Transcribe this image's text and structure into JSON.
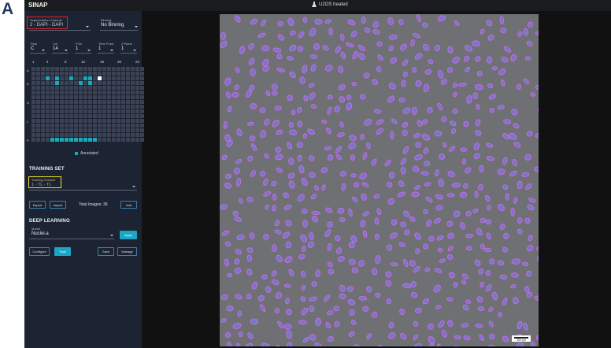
{
  "panel_letter": "A",
  "app": {
    "title": "SINAP",
    "topbar_label": "U2OS treated"
  },
  "sidebar": {
    "segmentation_channel": {
      "label": "Segmentation Channel",
      "value": "2 - DAPI - DAPI"
    },
    "binning": {
      "label": "Binning",
      "value": "No Binning"
    },
    "selectors": [
      {
        "label": "Row",
        "value": "C"
      },
      {
        "label": "Col",
        "value": "14"
      },
      {
        "label": "FOV",
        "value": "1"
      },
      {
        "label": "Time Point",
        "value": "1"
      },
      {
        "label": "Z Plane",
        "value": "1"
      }
    ],
    "plate": {
      "col_ticks": [
        "1",
        "4",
        "8",
        "12",
        "16",
        "20",
        "24"
      ],
      "row_labels": [
        "A",
        "D",
        "H",
        "L",
        "P"
      ],
      "rows": 16,
      "cols": 24,
      "annotated_wells": [
        [
          2,
          3
        ],
        [
          2,
          5
        ],
        [
          2,
          8
        ],
        [
          2,
          11
        ],
        [
          2,
          12
        ],
        [
          3,
          5
        ],
        [
          3,
          10
        ],
        [
          3,
          12
        ],
        [
          15,
          4
        ],
        [
          15,
          5
        ],
        [
          15,
          6
        ],
        [
          15,
          7
        ],
        [
          15,
          8
        ],
        [
          15,
          9
        ],
        [
          15,
          10
        ],
        [
          15,
          11
        ],
        [
          15,
          12
        ],
        [
          15,
          13
        ]
      ],
      "selected_well": [
        2,
        14
      ],
      "legend": "Annotated"
    },
    "training_set": {
      "heading": "TRAINING SET",
      "training_channel": {
        "label": "Training Channel",
        "value": "1 - TL - TL"
      },
      "export_label": "Export",
      "import_label": "Import",
      "total_images": "Total Images: 36",
      "add_label": "Add"
    },
    "deep_learning": {
      "heading": "DEEP LEARNING",
      "model": {
        "label": "Model",
        "value": "Nuclei.a"
      },
      "apply_label": "Apply",
      "configure_label": "Configure",
      "train_label": "Train",
      "save_label": "Save",
      "manage_label": "Manage"
    }
  },
  "image": {
    "scale_bar": "100 µm"
  },
  "colors": {
    "sidebar_bg": "#1c2333",
    "accent": "#1aa6c4",
    "annotated": "#1aa9b9",
    "segmentation_outline": "#d36bf0",
    "nucleus_fill": "#7f76d6"
  }
}
